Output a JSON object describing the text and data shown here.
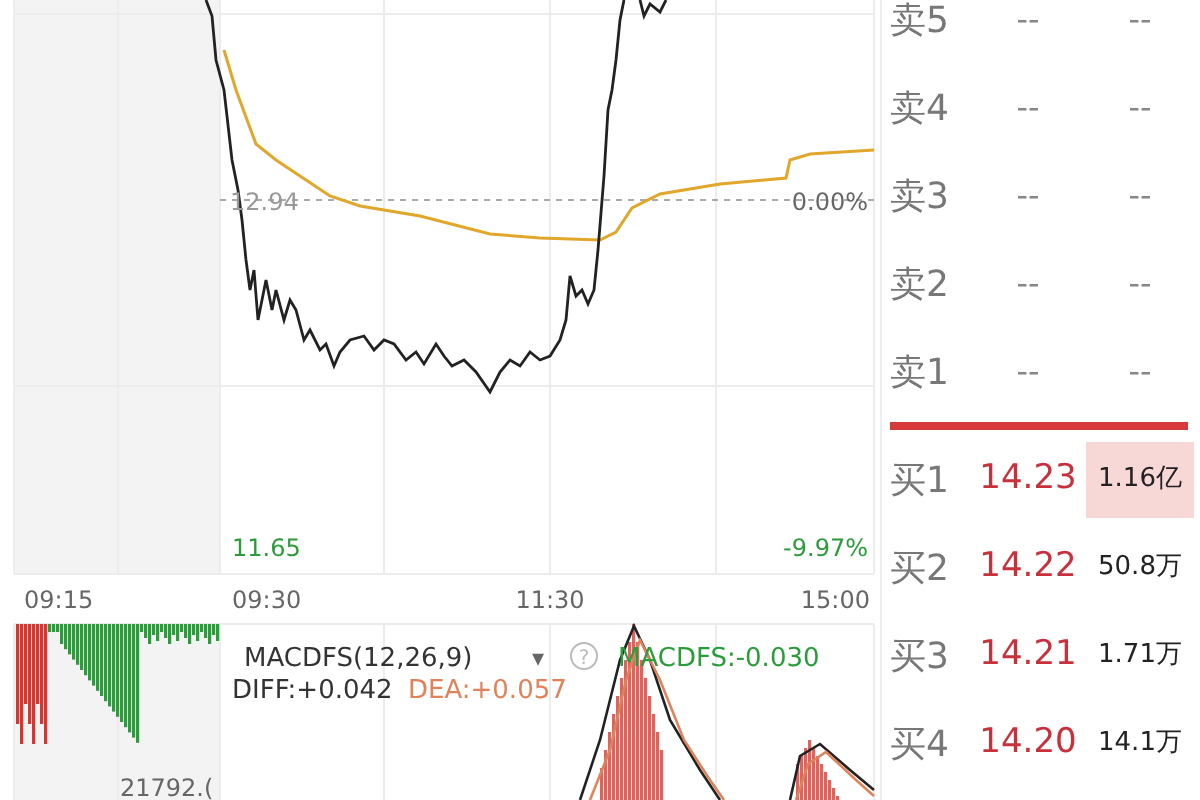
{
  "chart": {
    "ref_price": "12.94",
    "ref_pct": "0.00%",
    "low_price": "11.65",
    "low_pct": "-9.97%",
    "times": [
      "09:15",
      "09:30",
      "11:30",
      "15:00"
    ]
  },
  "macd": {
    "title": "MACDFS(12,26,9)",
    "dropdown": "▾",
    "help": "?",
    "value": "MACDFS:-0.030",
    "diff": "DIFF:+0.042",
    "dea": "DEA:+0.057",
    "volume": "21792.("
  },
  "order_book": {
    "asks": [
      {
        "label": "卖5",
        "price": "--",
        "volume": "--"
      },
      {
        "label": "卖4",
        "price": "--",
        "volume": "--"
      },
      {
        "label": "卖3",
        "price": "--",
        "volume": "--"
      },
      {
        "label": "卖2",
        "price": "--",
        "volume": "--"
      },
      {
        "label": "卖1",
        "price": "--",
        "volume": "--"
      }
    ],
    "bids": [
      {
        "label": "买1",
        "price": "14.23",
        "volume": "1.16亿",
        "highlighted": true
      },
      {
        "label": "买2",
        "price": "14.22",
        "volume": "50.8万",
        "highlighted": false
      },
      {
        "label": "买3",
        "price": "14.21",
        "volume": "1.71万",
        "highlighted": false
      },
      {
        "label": "买4",
        "price": "14.20",
        "volume": "14.1万",
        "highlighted": false
      }
    ]
  }
}
